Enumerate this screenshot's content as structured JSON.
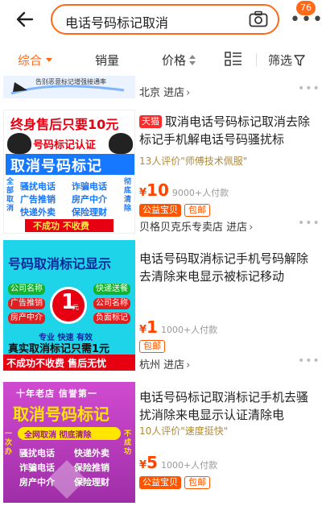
{
  "header": {
    "search_query": "电话号码标记取消",
    "notification_count": "76"
  },
  "sort_bar": {
    "comprehensive": "综合",
    "sales": "销量",
    "price": "价格",
    "filter": "筛选"
  },
  "top_item": {
    "image_banner": "告别恶意标记增强接通率",
    "shop_name": "北京 进店"
  },
  "items": [
    {
      "tag": "天猫",
      "title": "取消电话号码标记取消去除标记手机解电话号码骚扰标",
      "review": "13人评价\"师傅技术佩服\"",
      "price": "10",
      "paid": "9000+人付款",
      "chips": [
        "公益宝贝",
        "包邮"
      ],
      "shop": "贝格贝克乐专卖店 进店",
      "image": {
        "headline": "终身售后只要10元",
        "sub": "号码标记认证",
        "main": "取消号码标记",
        "left_side": "全部取消",
        "right_side": "彻底清除",
        "grid": [
          "骚扰电话",
          "诈骗电话",
          "广告推销",
          "房产中介",
          "快递外卖",
          "保险理财"
        ],
        "bottom": "不成功 不收费"
      }
    },
    {
      "title": "电话号码取消标记手机号码解除去清除来电显示被标记移动",
      "price": "1",
      "paid": "1000+人付款",
      "chips": [
        "包邮"
      ],
      "shop": "杭州 进店",
      "image": {
        "headline": "号码取消标记显示",
        "labels_left": [
          "公司名称",
          "广告推销",
          "房产中介"
        ],
        "labels_right": [
          "快递送餐",
          "公司名称",
          "负面标记"
        ],
        "center": "1",
        "center_unit": "元",
        "slogan": "专业 快速 有效",
        "line1": "真实取消标记只需1元",
        "line2": "不成功不收费 售后无忧"
      }
    },
    {
      "title": "电话号码标记取消标记手机去骚扰消除来电显示认证清除电",
      "review": "10人评价\"速度挺快\"",
      "price": "5",
      "paid": "1000+人付款",
      "chips": [
        "公益宝贝",
        "包邮"
      ],
      "image": {
        "top": "十年老店 信誉第一",
        "main": "取消号码标记",
        "bar": "全网取消 彻底清除",
        "left_side": "一次办",
        "right_side": "不成功",
        "grid": [
          "骚扰电话",
          "快递外卖",
          "诈骗电话",
          "保险推销",
          "房产中介",
          "保险理财"
        ]
      }
    }
  ],
  "icons": {
    "back": "arrow-left-icon",
    "camera": "camera-icon",
    "more": "more-dots-icon",
    "grid": "list-grid-icon",
    "filter": "funnel-icon"
  },
  "colors": {
    "accent": "#ff6a1a",
    "price": "#ff4400",
    "tmall": "#ff2a2a",
    "review": "#b08a3a"
  }
}
